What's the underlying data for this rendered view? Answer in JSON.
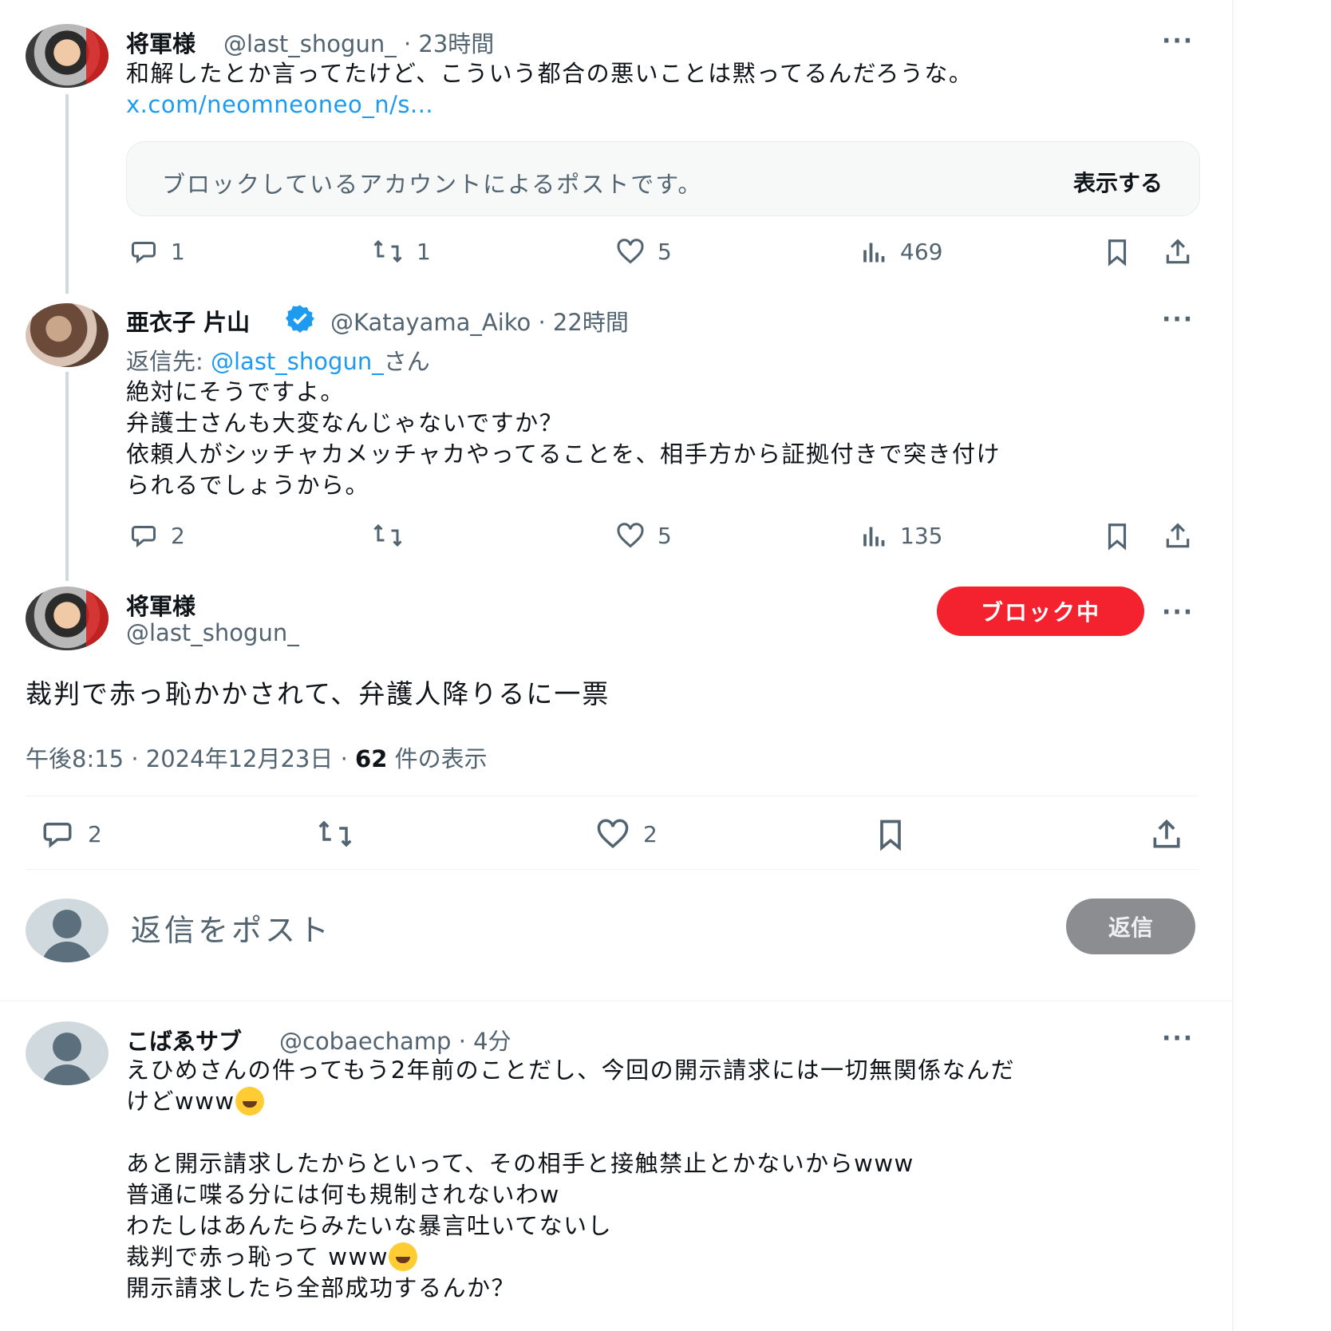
{
  "tweet1": {
    "display_name": "将軍様",
    "handle": "@last_shogun_",
    "time": "· 23時間",
    "text": "和解したとか言ってたけど、こういう都合の悪いことは黙ってるんだろうな。",
    "link": "x.com/neomneoneo_n/s...",
    "blocked_card": {
      "message": "ブロックしているアカウントによるポストです。",
      "show_label": "表示する"
    },
    "actions": {
      "replies": "1",
      "reposts": "1",
      "likes": "5",
      "views": "469"
    },
    "more": "···"
  },
  "tweet2": {
    "display_name": "亜衣子 片山",
    "handle": "@Katayama_Aiko",
    "time": "· 22時間",
    "reply_to_prefix": "返信先:",
    "reply_to_handle": "@last_shogun_",
    "reply_to_suffix": "さん",
    "lines": [
      "絶対にそうですよ。",
      "弁護士さんも大変なんじゃないですか？",
      "依頼人がシッチャカメッチャカやってることを、相手方から証拠付きで突き付け",
      "られるでしょうから。"
    ],
    "actions": {
      "replies": "2",
      "reposts": "",
      "likes": "5",
      "views": "135"
    },
    "more": "···"
  },
  "main_tweet": {
    "display_name": "将軍様",
    "handle": "@last_shogun_",
    "block_button": "ブロック中",
    "text": "裁判で赤っ恥かかされて、弁護人降りるに一票",
    "timestamp": "午後8:15 · 2024年12月23日 · ",
    "views_count": "62",
    "views_label": " 件の表示",
    "actions": {
      "replies": "2",
      "likes": "2"
    },
    "more": "···"
  },
  "reply_composer": {
    "placeholder": "返信をポスト",
    "button": "返信"
  },
  "tweet3": {
    "display_name": "こばゑサブ",
    "handle": "@cobaechamp",
    "time": "· 4分",
    "lines": [
      "えひめさんの件ってもう2年前のことだし、今回の開示請求には一切無関係なんだ",
      "けどwww",
      "",
      "あと開示請求したからといって、その相手と接触禁止とかないからwww",
      "普通に喋る分には何も規制されないわw",
      "わたしはあんたらみたいな暴言吐いてないし",
      "裁判で赤っ恥って www",
      "開示請求したら全部成功するんか？"
    ],
    "emojis": [
      "rolling-on-floor-laughing",
      "rolling-on-floor-laughing"
    ],
    "more": "···"
  },
  "colors": {
    "accent": "#1d9bf0",
    "block_red": "#f4212e",
    "muted": "#536471"
  }
}
